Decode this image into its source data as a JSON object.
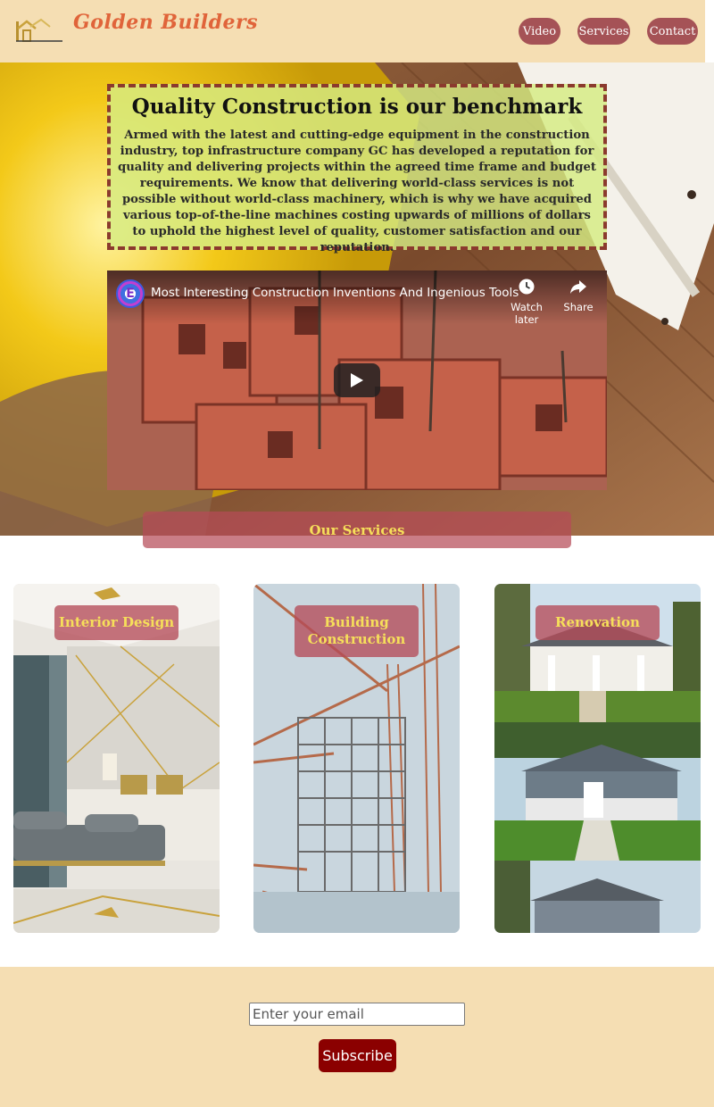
{
  "header": {
    "logo_text": "Golden Builders",
    "nav": [
      {
        "label": "Video"
      },
      {
        "label": "Services"
      },
      {
        "label": "Contact"
      }
    ]
  },
  "hero": {
    "title": "Quality Construction is our benchmark",
    "description": "Armed with the latest and cutting-edge equipment in the construction industry, top infrastructure company GC has developed a reputation for quality and delivering projects within the agreed time frame and budget requirements. We know that delivering world-class services is not possible without world-class machinery, which is why we have acquired various top-of-the-line machines costing upwards of millions of dollars to uphold the highest level of quality, customer satisfaction and our reputation."
  },
  "video": {
    "channel_initial": "E",
    "title": "Most Interesting Construction Inventions And Ingenious Tools",
    "watch_later": "Watch later",
    "share": "Share"
  },
  "services": {
    "heading": "Our Services",
    "cards": [
      {
        "label": "Interior Design"
      },
      {
        "label": "Building Construction"
      },
      {
        "label": "Renovation"
      }
    ]
  },
  "footer": {
    "email_placeholder": "Enter your email",
    "subscribe_label": "Subscribe"
  },
  "colors": {
    "header_bg": "#f5deb3",
    "nav_button": "#a55256",
    "logo_text": "#e0643a",
    "label_text": "#f6df5a",
    "subscribe_button": "#8b0000"
  }
}
